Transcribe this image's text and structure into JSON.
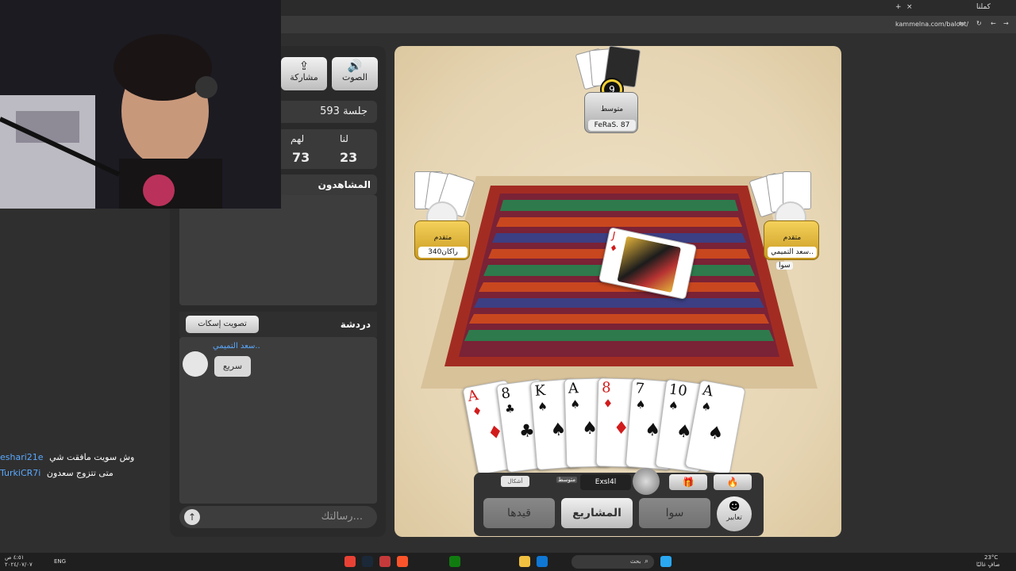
{
  "browser": {
    "tab_title": "كملنا",
    "url": "kammelna.com/baloot/"
  },
  "toolbar": {
    "sound_label": "الصوت",
    "share_label": "مشاركة"
  },
  "session": {
    "label": "جلسة 593"
  },
  "score": {
    "us_label": "لنا",
    "them_label": "لهم",
    "us_value": "23",
    "them_value": "73"
  },
  "watchers": {
    "title": "المشاهدون"
  },
  "chat": {
    "title": "دردشة",
    "mute_vote_label": "تصويت إسكات",
    "messages": [
      {
        "author": "سعد التميمي..",
        "text": "سريع"
      }
    ],
    "input_placeholder": "رسالتك..."
  },
  "stream_chat": [
    {
      "user": "eshari21e",
      "text": "وش سويت مافقت شي"
    },
    {
      "user": "TurkiCR7i",
      "text": "متى تتزوج سعدون"
    }
  ],
  "players": {
    "top": {
      "level": "متوسط",
      "name": "FeRaS. 87",
      "timer": "9"
    },
    "left": {
      "level": "متقدم",
      "name": "راكان340"
    },
    "right": {
      "level": "متقدم",
      "name": "سعد التميمي..",
      "tag": "سوا"
    },
    "me": {
      "level": "متوسط",
      "name": "Exsl4l",
      "shapes_label": "أشكال"
    }
  },
  "table_card": {
    "rank": "J",
    "suit": "♦"
  },
  "hand": [
    {
      "rank": "A",
      "suit": "♦",
      "color": "#d21c1c"
    },
    {
      "rank": "8",
      "suit": "♣",
      "color": "#111111"
    },
    {
      "rank": "K",
      "suit": "♠",
      "color": "#111111"
    },
    {
      "rank": "A",
      "suit": "♠",
      "color": "#111111"
    },
    {
      "rank": "8",
      "suit": "♦",
      "color": "#d21c1c"
    },
    {
      "rank": "7",
      "suit": "♠",
      "color": "#111111"
    },
    {
      "rank": "10",
      "suit": "♠",
      "color": "#111111"
    },
    {
      "rank": "A",
      "suit": "♠",
      "color": "#111111"
    }
  ],
  "actions": {
    "expressions_label": "تعابير",
    "sawa_label": "سوا",
    "projects_label": "المشاريع",
    "record_label": "قيدها"
  },
  "taskbar": {
    "search_placeholder": "بحث",
    "weather_temp": "23°C",
    "weather_desc": "صافٍ غالبًا",
    "lang": "ENG",
    "time": "٤:٥١ ص",
    "date": "٢٠٢٤/٠٧/٠٧"
  }
}
